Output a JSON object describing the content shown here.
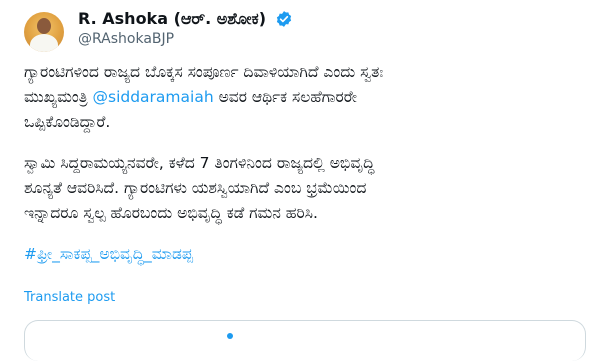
{
  "user": {
    "display_name": "R. Ashoka (ಆರ್. ಅಶೋಕ)",
    "handle": "@RAshokaBJP",
    "verified": true
  },
  "tweet": {
    "p1_line1": "ಗ್ಯಾರಂಟಿಗಳಿಂದ ರಾಜ್ಯದ ಬೊಕ್ಕಸ ಸಂಪೂರ್ಣ ದಿವಾಳಿಯಾಗಿದೆ ಎಂದು ಸ್ವತಃ",
    "p1_line2_prefix": "ಮುಖ್ಯಮಂತ್ರಿ ",
    "mention": "@siddaramaiah",
    "p1_line2_suffix": " ಅವರ ಆರ್ಥಿಕ ಸಲಹೆಗಾರರೇ",
    "p1_line3": "ಒಪ್ಪಿಕೊಂಡಿದ್ದಾರೆ.",
    "p2_line1": "ಸ್ವಾಮಿ ಸಿದ್ದರಾಮಯ್ಯನವರೇ, ಕಳೆದ 7 ತಿಂಗಳಿನಿಂದ ರಾಜ್ಯದಲ್ಲಿ ಅಭಿವೃದ್ಧಿ",
    "p2_line2": "ಶೂನ್ಯತೆ ಆವರಿಸಿದೆ. ಗ್ಯಾರಂಟಿಗಳು ಯಶಸ್ವಿಯಾಗಿದೆ ಎಂಬ ಭ್ರಮೆಯಿಂದ",
    "p2_line3": "ಇನ್ನಾದರೂ ಸ್ವಲ್ಪ ಹೊರಬಂದು ಅಭಿವೃದ್ಧಿ ಕಡೆ ಗಮನ ಹರಿಸಿ.",
    "hashtag": "#ಫ್ರೀ_ಸಾಕಪ್ಪ_ಅಭಿವೃದ್ಧಿ_ಮಾಡಪ್ಪ"
  },
  "actions": {
    "translate_label": "Translate post"
  },
  "colors": {
    "accent": "#1d9bf0",
    "secondary_text": "#536471",
    "primary_text": "#0f1419"
  }
}
